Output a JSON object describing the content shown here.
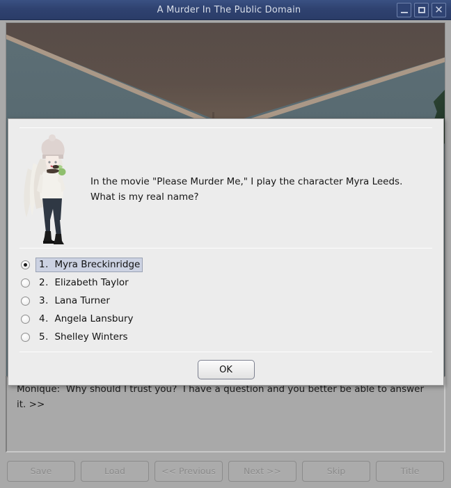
{
  "window": {
    "title": "A Murder In The Public Domain",
    "controls": [
      {
        "name": "minimize-button",
        "icon": "minimize-icon",
        "label": "_"
      },
      {
        "name": "maximize-button",
        "icon": "maximize-icon",
        "label": "□"
      },
      {
        "name": "close-button",
        "icon": "close-icon",
        "label": "✕"
      }
    ]
  },
  "scene": {
    "description": "room-interior-ceiling-corner"
  },
  "dialogue": {
    "text": "Monique:  Why should I trust you?  I have a question and you better be able to answer it. >>"
  },
  "quiz": {
    "character_sprite": "monique-sprite",
    "question": "In the movie \"Please Murder Me,\" I play the character Myra Leeds.\nWhat is my real name?",
    "options": [
      {
        "num": "1.",
        "text": "Myra Breckinridge",
        "selected": true
      },
      {
        "num": "2.",
        "text": "Elizabeth Taylor",
        "selected": false
      },
      {
        "num": "3.",
        "text": "Lana Turner",
        "selected": false
      },
      {
        "num": "4.",
        "text": "Angela Lansbury",
        "selected": false
      },
      {
        "num": "5.",
        "text": "Shelley Winters",
        "selected": false
      }
    ],
    "ok_label": "OK"
  },
  "toolbar": {
    "buttons": [
      {
        "label": "Save",
        "name": "save-button",
        "enabled": false
      },
      {
        "label": "Load",
        "name": "load-button",
        "enabled": false
      },
      {
        "label": "<< Previous",
        "name": "previous-button",
        "enabled": false
      },
      {
        "label": "Next >>",
        "name": "next-button",
        "enabled": false
      },
      {
        "label": "Skip",
        "name": "skip-button",
        "enabled": false
      },
      {
        "label": "Title",
        "name": "title-button",
        "enabled": false
      }
    ]
  },
  "colors": {
    "titlebar": "#2f4270",
    "window_bg": "#a9a9a9",
    "modal_bg": "#ececec",
    "selection": "#ccd2e2"
  }
}
